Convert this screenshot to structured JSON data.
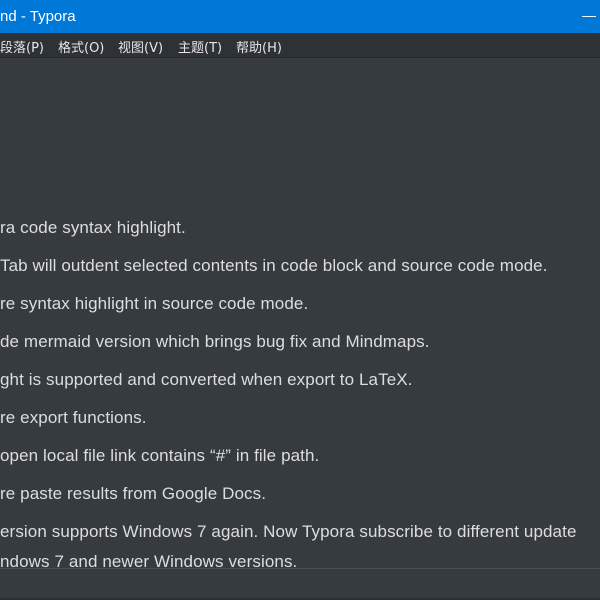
{
  "window": {
    "title": "nd - Typora",
    "minimize_glyph": "—"
  },
  "menu": [
    {
      "label": "段落(P)"
    },
    {
      "label": "格式(O)"
    },
    {
      "label": "视图(V)"
    },
    {
      "label": "主题(T)"
    },
    {
      "label": "帮助(H)"
    }
  ],
  "content": {
    "lines": [
      "ra code syntax highlight.",
      "Tab will outdent selected contents in code block and source code mode.",
      "re syntax highlight in source code mode.",
      "de mermaid version which brings bug fix and Mindmaps.",
      "ght is supported and converted when export to LaTeX.",
      "re export functions.",
      "open local file link contains “#” in file path.",
      "re paste results from Google Docs.",
      "ersion supports Windows 7 again. Now Typora subscribe to different update",
      "ndows 7 and newer Windows versions."
    ]
  },
  "colors": {
    "titlebar": "#0078d7",
    "menubar": "#2e3136",
    "editor_background": "#363b40",
    "text": "#dddddd"
  }
}
